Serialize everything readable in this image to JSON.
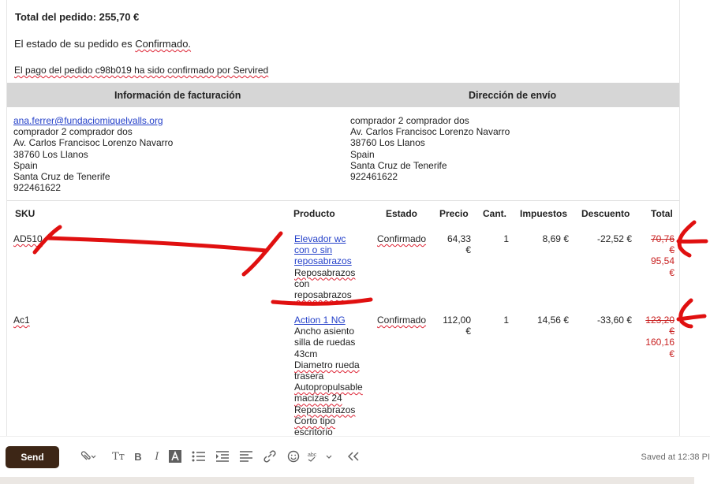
{
  "order": {
    "total_label": "Total del pedido:",
    "total_value": "255,70 €",
    "status_prefix": "El estado de su pedido es ",
    "status_value": "Confirmado.",
    "payment_text": "El pago del pedido c98b019 ha sido confirmado por Servired"
  },
  "billing": {
    "heading": "Información de facturación",
    "email": "ana.ferrer@fundaciomiquelvalls.org",
    "lines": [
      "comprador 2 comprador dos",
      "Av. Carlos Francisoc Lorenzo Navarro",
      "38760 Los Llanos",
      "Spain",
      "Santa Cruz de Tenerife",
      "922461622"
    ]
  },
  "shipping": {
    "heading": "Dirección de envío",
    "lines": [
      "comprador 2 comprador dos",
      "Av. Carlos Francisoc Lorenzo Navarro",
      "38760 Los Llanos",
      "Spain",
      "Santa Cruz de Tenerife",
      "922461622"
    ]
  },
  "items_table": {
    "headers": {
      "sku": "SKU",
      "product": "Producto",
      "status": "Estado",
      "price": "Precio",
      "qty": "Cant.",
      "tax": "Impuestos",
      "discount": "Descuento",
      "total": "Total"
    },
    "rows": [
      {
        "sku": "AD510",
        "product_link": [
          "Elevador wc",
          "con o sin",
          "reposabrazos"
        ],
        "product_desc": [
          "Reposabrazos",
          "con",
          "reposabrazos"
        ],
        "status": "Confirmado",
        "price": [
          "64,33",
          "€"
        ],
        "qty": "1",
        "tax": "8,69 €",
        "discount": "-22,52 €",
        "total_old": [
          "70,76",
          "€"
        ],
        "total_new": [
          "95,54",
          "€"
        ]
      },
      {
        "sku": "Ac1",
        "product_link": [
          "Action 1 NG"
        ],
        "product_desc": [
          "Ancho asiento",
          "silla de ruedas",
          "43cm",
          "Diametro rueda",
          "trasera",
          "Autopropulsable",
          "macizas 24",
          "Reposabrazos",
          "Corto tipo",
          "escritorio"
        ],
        "status": "Confirmado",
        "price": [
          "112,00",
          "€"
        ],
        "qty": "1",
        "tax": "14,56 €",
        "discount": "-33,60 €",
        "total_old": [
          "123,20",
          "€"
        ],
        "total_new": [
          "160,16",
          "€"
        ]
      }
    ]
  },
  "toolbar": {
    "send_label": "Send",
    "saved_text": "Saved at 12:38 PI"
  },
  "colors": {
    "annotation": "#e01010",
    "send_button": "#3d2616",
    "header_bg": "#d6d6d6",
    "link": "#2440c9"
  }
}
